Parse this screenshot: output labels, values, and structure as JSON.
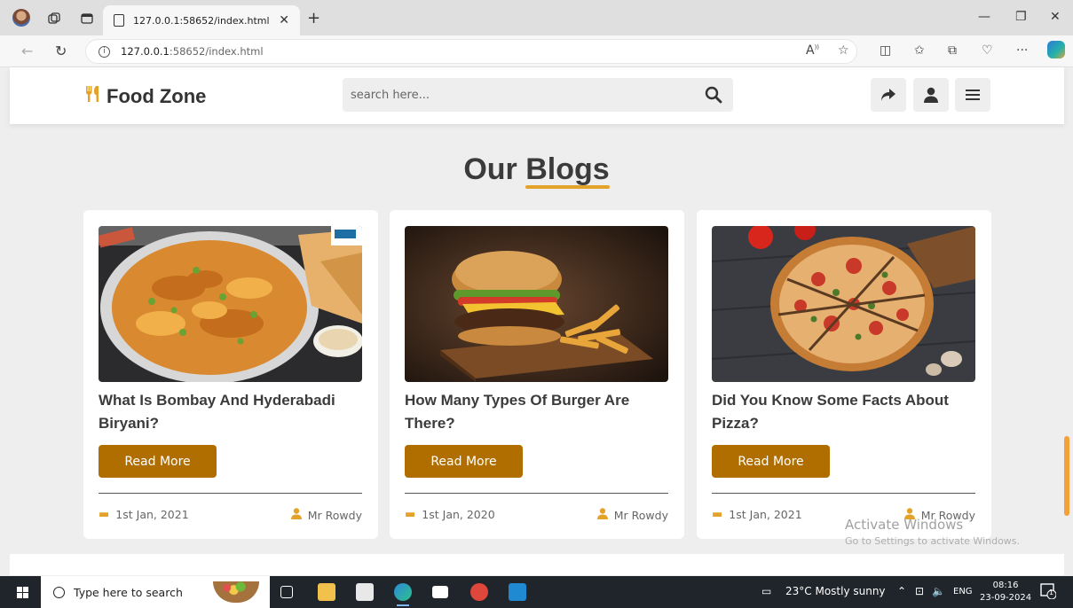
{
  "browser": {
    "tab_title": "127.0.0.1:58652/index.html",
    "url_host": "127.0.0.1",
    "url_rest": ":58652/index.html"
  },
  "site": {
    "logo_text": "Food Zone",
    "search_placeholder": "search here..."
  },
  "section": {
    "title_plain": "Our",
    "title_accent": "Blogs"
  },
  "blogs": [
    {
      "title": "What Is Bombay And Hyderabadi Biryani?",
      "button": "Read More",
      "date": "1st Jan, 2021",
      "author": "Mr Rowdy",
      "image": "biryani"
    },
    {
      "title": "How Many Types Of Burger Are There?",
      "button": "Read More",
      "date": "1st Jan, 2020",
      "author": "Mr Rowdy",
      "image": "burger"
    },
    {
      "title": "Did You Know Some Facts About Pizza?",
      "button": "Read More",
      "date": "1st Jan, 2021",
      "author": "Mr Rowdy",
      "image": "pizza"
    }
  ],
  "watermark": {
    "line1": "Activate Windows",
    "line2": "Go to Settings to activate Windows."
  },
  "taskbar": {
    "search_placeholder": "Type here to search",
    "weather": "23°C  Mostly sunny",
    "lang": "ENG",
    "time": "08:16",
    "date": "23-09-2024",
    "notification_count": "1"
  }
}
